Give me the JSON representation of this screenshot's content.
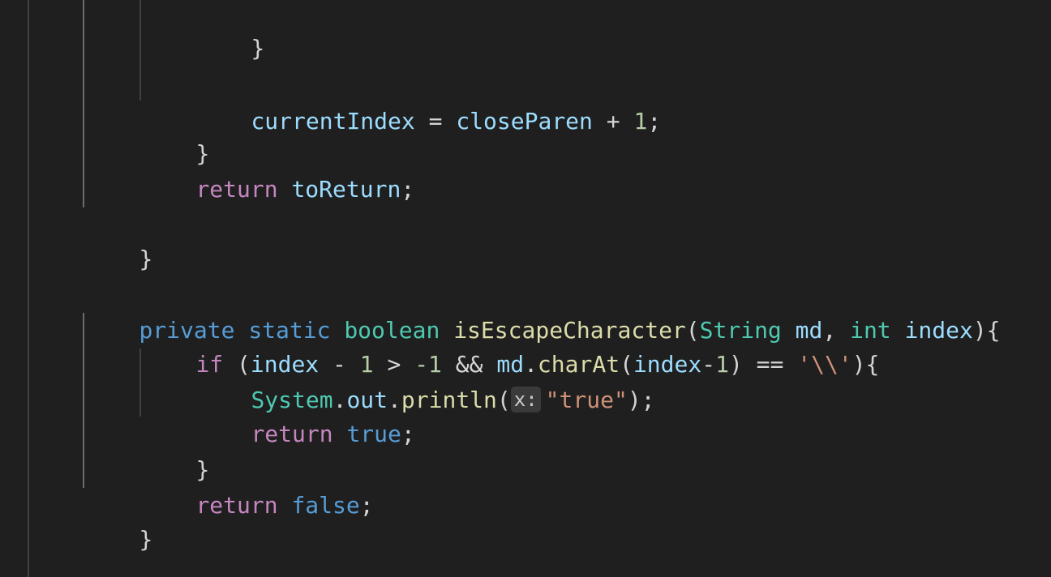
{
  "code": {
    "close_brace": "}",
    "current_index_line": {
      "var": "currentIndex",
      "op_assign": " = ",
      "var2": "closeParen",
      "op_plus": " + ",
      "num": "1",
      "semi": ";"
    },
    "return_to_return": {
      "kw": "return",
      "sp": " ",
      "var": "toReturn",
      "semi": ";"
    },
    "method_signature": {
      "private": "private",
      "static": "static",
      "boolean": "boolean",
      "name": "isEscapeCharacter",
      "open_paren": "(",
      "type1": "String",
      "param1": "md",
      "comma": ", ",
      "type2": "int",
      "param2": "index",
      "close": "){"
    },
    "if_line": {
      "kw": "if",
      "open": " (",
      "var1": "index",
      "minus": " - ",
      "num1": "1",
      "gt": " > ",
      "neg": "-1",
      "and": " && ",
      "var2": "md",
      "dot": ".",
      "fn": "charAt",
      "paren_open": "(",
      "var3": "index",
      "minus2": "-",
      "num2": "1",
      "paren_close": ")",
      "eq": " == ",
      "char": "'\\\\'",
      "close": "){"
    },
    "println_line": {
      "type": "System",
      "dot1": ".",
      "field": "out",
      "dot2": ".",
      "fn": "println",
      "open": "(",
      "hint": "x:",
      "str": "\"true\"",
      "close": ");"
    },
    "return_true": {
      "kw": "return",
      "val": "true",
      "semi": ";"
    },
    "return_false": {
      "kw": "return",
      "val": "false",
      "semi": ";"
    }
  },
  "colors": {
    "background": "#1f1f1f",
    "keyword_control": "#c586c0",
    "keyword": "#569cd6",
    "type": "#4ec9b0",
    "function": "#dcdcaa",
    "variable": "#9cdcfe",
    "number": "#b5cea8",
    "string": "#ce9178"
  }
}
